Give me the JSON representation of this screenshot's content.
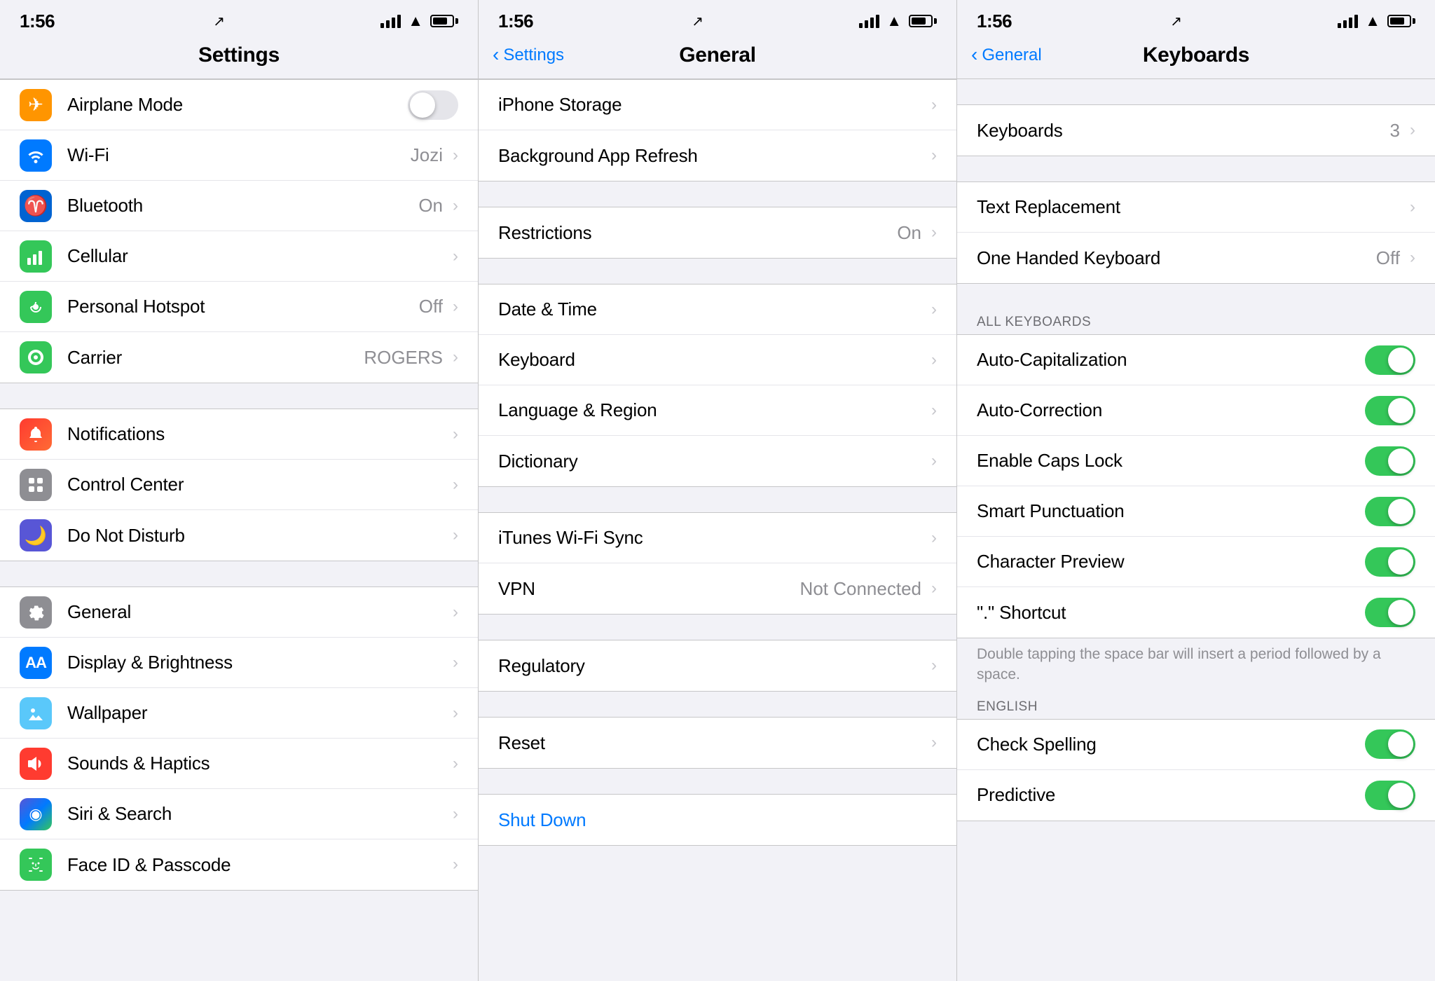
{
  "screens": [
    {
      "id": "settings-main",
      "statusBar": {
        "time": "1:56",
        "locationIcon": true
      },
      "header": {
        "title": "Settings",
        "backLabel": null
      },
      "sections": [
        {
          "id": "connectivity",
          "rows": [
            {
              "id": "airplane-mode",
              "iconColor": "icon-orange",
              "iconSymbol": "✈",
              "label": "Airplane Mode",
              "value": null,
              "toggle": "off",
              "chevron": false
            },
            {
              "id": "wifi",
              "iconColor": "icon-blue",
              "iconSymbol": "📶",
              "label": "Wi-Fi",
              "value": "Jozi",
              "toggle": null,
              "chevron": true
            },
            {
              "id": "bluetooth",
              "iconColor": "icon-blue-dark",
              "iconSymbol": "⚡",
              "label": "Bluetooth",
              "value": "On",
              "toggle": null,
              "chevron": true
            },
            {
              "id": "cellular",
              "iconColor": "icon-green",
              "iconSymbol": "📡",
              "label": "Cellular",
              "value": null,
              "toggle": null,
              "chevron": true
            },
            {
              "id": "personal-hotspot",
              "iconColor": "icon-green",
              "iconSymbol": "🔗",
              "label": "Personal Hotspot",
              "value": "Off",
              "toggle": null,
              "chevron": true
            },
            {
              "id": "carrier",
              "iconColor": "icon-green",
              "iconSymbol": "📞",
              "label": "Carrier",
              "value": "ROGERS",
              "toggle": null,
              "chevron": true
            }
          ]
        },
        {
          "id": "controls",
          "rows": [
            {
              "id": "notifications",
              "iconColor": "icon-gradient-notifications",
              "iconSymbol": "🔔",
              "label": "Notifications",
              "value": null,
              "toggle": null,
              "chevron": true
            },
            {
              "id": "control-center",
              "iconColor": "icon-gray",
              "iconSymbol": "⊞",
              "label": "Control Center",
              "value": null,
              "toggle": null,
              "chevron": true
            },
            {
              "id": "do-not-disturb",
              "iconColor": "icon-indigo",
              "iconSymbol": "🌙",
              "label": "Do Not Disturb",
              "value": null,
              "toggle": null,
              "chevron": true
            }
          ]
        },
        {
          "id": "preferences",
          "rows": [
            {
              "id": "general",
              "iconColor": "icon-gray",
              "iconSymbol": "⚙",
              "label": "General",
              "value": null,
              "toggle": null,
              "chevron": true
            },
            {
              "id": "display-brightness",
              "iconColor": "icon-blue",
              "iconSymbol": "AA",
              "label": "Display & Brightness",
              "value": null,
              "toggle": null,
              "chevron": true
            },
            {
              "id": "wallpaper",
              "iconColor": "icon-teal",
              "iconSymbol": "❋",
              "label": "Wallpaper",
              "value": null,
              "toggle": null,
              "chevron": true
            },
            {
              "id": "sounds-haptics",
              "iconColor": "icon-red",
              "iconSymbol": "🔊",
              "label": "Sounds & Haptics",
              "value": null,
              "toggle": null,
              "chevron": true
            },
            {
              "id": "siri-search",
              "iconColor": "icon-gradient-siri",
              "iconSymbol": "◎",
              "label": "Siri & Search",
              "value": null,
              "toggle": null,
              "chevron": true
            },
            {
              "id": "face-id",
              "iconColor": "icon-green",
              "iconSymbol": "⬡",
              "label": "Face ID & Passcode",
              "value": null,
              "toggle": null,
              "chevron": true
            }
          ]
        }
      ]
    },
    {
      "id": "general",
      "statusBar": {
        "time": "1:56",
        "locationIcon": true
      },
      "header": {
        "title": "General",
        "backLabel": "Settings"
      },
      "sections": [
        {
          "id": "storage-section",
          "rows": [
            {
              "id": "iphone-storage",
              "label": "iPhone Storage",
              "value": null,
              "chevron": true
            },
            {
              "id": "background-app-refresh",
              "label": "Background App Refresh",
              "value": null,
              "chevron": true
            }
          ]
        },
        {
          "id": "restrictions-section",
          "rows": [
            {
              "id": "restrictions",
              "label": "Restrictions",
              "value": "On",
              "chevron": true
            }
          ]
        },
        {
          "id": "date-lang-section",
          "rows": [
            {
              "id": "date-time",
              "label": "Date & Time",
              "value": null,
              "chevron": true
            },
            {
              "id": "keyboard",
              "label": "Keyboard",
              "value": null,
              "chevron": true
            },
            {
              "id": "language-region",
              "label": "Language & Region",
              "value": null,
              "chevron": true
            },
            {
              "id": "dictionary",
              "label": "Dictionary",
              "value": null,
              "chevron": true
            }
          ]
        },
        {
          "id": "itunes-section",
          "rows": [
            {
              "id": "itunes-wifi-sync",
              "label": "iTunes Wi-Fi Sync",
              "value": null,
              "chevron": true
            },
            {
              "id": "vpn",
              "label": "VPN",
              "value": "Not Connected",
              "chevron": true
            }
          ]
        },
        {
          "id": "regulatory-section",
          "rows": [
            {
              "id": "regulatory",
              "label": "Regulatory",
              "value": null,
              "chevron": true
            }
          ]
        },
        {
          "id": "reset-section",
          "rows": [
            {
              "id": "reset",
              "label": "Reset",
              "value": null,
              "chevron": true
            }
          ]
        },
        {
          "id": "shutdown-section",
          "rows": [
            {
              "id": "shut-down",
              "label": "Shut Down",
              "isBlue": true,
              "value": null,
              "chevron": false
            }
          ]
        }
      ]
    },
    {
      "id": "keyboards",
      "statusBar": {
        "time": "1:56",
        "locationIcon": true
      },
      "header": {
        "title": "Keyboards",
        "backLabel": "General"
      },
      "sections": [
        {
          "id": "keyboards-list-section",
          "rows": [
            {
              "id": "keyboards-count",
              "label": "Keyboards",
              "value": "3",
              "chevron": true
            }
          ]
        },
        {
          "id": "text-options-section",
          "rows": [
            {
              "id": "text-replacement",
              "label": "Text Replacement",
              "value": null,
              "chevron": true
            },
            {
              "id": "one-handed-keyboard",
              "label": "One Handed Keyboard",
              "value": "Off",
              "chevron": true
            }
          ]
        },
        {
          "id": "all-keyboards-section",
          "headerLabel": "ALL KEYBOARDS",
          "rows": [
            {
              "id": "auto-capitalization",
              "label": "Auto-Capitalization",
              "toggle": "on"
            },
            {
              "id": "auto-correction",
              "label": "Auto-Correction",
              "toggle": "on"
            },
            {
              "id": "enable-caps-lock",
              "label": "Enable Caps Lock",
              "toggle": "on"
            },
            {
              "id": "smart-punctuation",
              "label": "Smart Punctuation",
              "toggle": "on"
            },
            {
              "id": "character-preview",
              "label": "Character Preview",
              "toggle": "on"
            },
            {
              "id": "period-shortcut",
              "label": "\".\" Shortcut",
              "toggle": "on"
            }
          ]
        },
        {
          "id": "period-description",
          "description": "Double tapping the space bar will insert a period followed by a space."
        },
        {
          "id": "english-section",
          "headerLabel": "ENGLISH",
          "rows": [
            {
              "id": "check-spelling",
              "label": "Check Spelling",
              "toggle": "on"
            },
            {
              "id": "predictive",
              "label": "Predictive",
              "toggle": "on"
            }
          ]
        }
      ]
    }
  ]
}
